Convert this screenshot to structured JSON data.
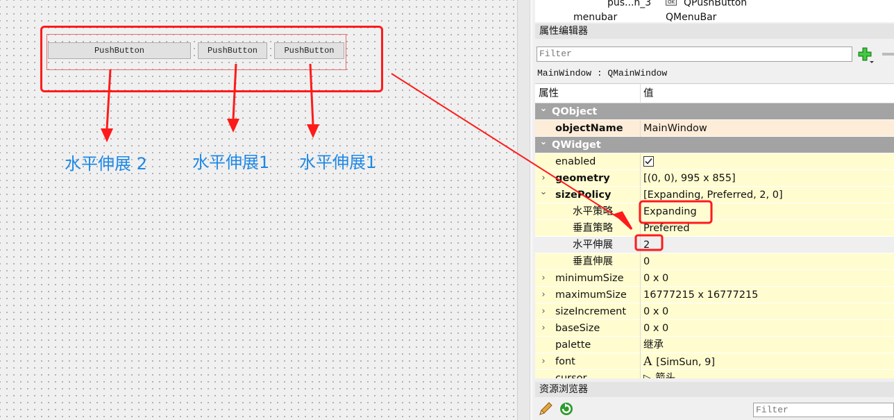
{
  "designer": {
    "buttons": [
      "PushButton",
      "PushButton",
      "PushButton"
    ],
    "annotations": [
      "水平伸展 2",
      "水平伸展1",
      "水平伸展1"
    ]
  },
  "object_tree": {
    "rows": [
      {
        "name": "pus...n_3",
        "class": "QPushButton",
        "icon": "ok-button-icon"
      },
      {
        "name": "menubar",
        "class": "QMenuBar"
      }
    ]
  },
  "property_editor": {
    "title": "属性编辑器",
    "filter_placeholder": "Filter",
    "add_icon": "plus-icon",
    "remove_icon": "minus-icon",
    "class_line": "MainWindow : QMainWindow",
    "col_property": "属性",
    "col_value": "值",
    "rows": [
      {
        "kind": "group",
        "name": "QObject",
        "expand": "v"
      },
      {
        "kind": "orange",
        "name": "objectName",
        "value": "MainWindow",
        "bold": true
      },
      {
        "kind": "group",
        "name": "QWidget",
        "expand": "v"
      },
      {
        "kind": "yellow",
        "name": "enabled",
        "value": "",
        "checkbox": true
      },
      {
        "kind": "yellow",
        "name": "geometry",
        "value": "[(0, 0), 995 x 855]",
        "bold": true,
        "expand": ">"
      },
      {
        "kind": "yellow",
        "name": "sizePolicy",
        "value": "[Expanding, Preferred, 2, 0]",
        "bold": true,
        "expand": "v"
      },
      {
        "kind": "yellow",
        "name": "水平策略",
        "value": "Expanding",
        "indent": true
      },
      {
        "kind": "yellow",
        "name": "垂直策略",
        "value": "Preferred",
        "indent": true
      },
      {
        "kind": "grey",
        "name": "水平伸展",
        "value": "2",
        "indent": true
      },
      {
        "kind": "yellow",
        "name": "垂直伸展",
        "value": "0",
        "indent": true
      },
      {
        "kind": "yellow",
        "name": "minimumSize",
        "value": "0 x 0",
        "expand": ">"
      },
      {
        "kind": "yellow",
        "name": "maximumSize",
        "value": "16777215 x 16777215",
        "expand": ">"
      },
      {
        "kind": "yellow",
        "name": "sizeIncrement",
        "value": "0 x 0",
        "expand": ">"
      },
      {
        "kind": "yellow",
        "name": "baseSize",
        "value": "0 x 0",
        "expand": ">"
      },
      {
        "kind": "yellow",
        "name": "palette",
        "value": "继承"
      },
      {
        "kind": "yellow",
        "name": "font",
        "value": "[SimSun, 9]",
        "expand": ">",
        "font_glyph": "A"
      },
      {
        "kind": "yellow",
        "name": "cursor",
        "value": "箭头",
        "cursor_glyph": "▷"
      }
    ]
  },
  "resource_browser": {
    "title": "资源浏览器",
    "filter_placeholder": "Filter",
    "edit_icon": "pencil-icon",
    "reload_icon": "reload-icon"
  },
  "colors": {
    "annotation_red": "#ff1a1a",
    "annotation_blue": "#1e88e5",
    "row_yellow": "#fffcd0",
    "row_orange": "#fdecd8",
    "group_grey": "#a3a3a3"
  }
}
